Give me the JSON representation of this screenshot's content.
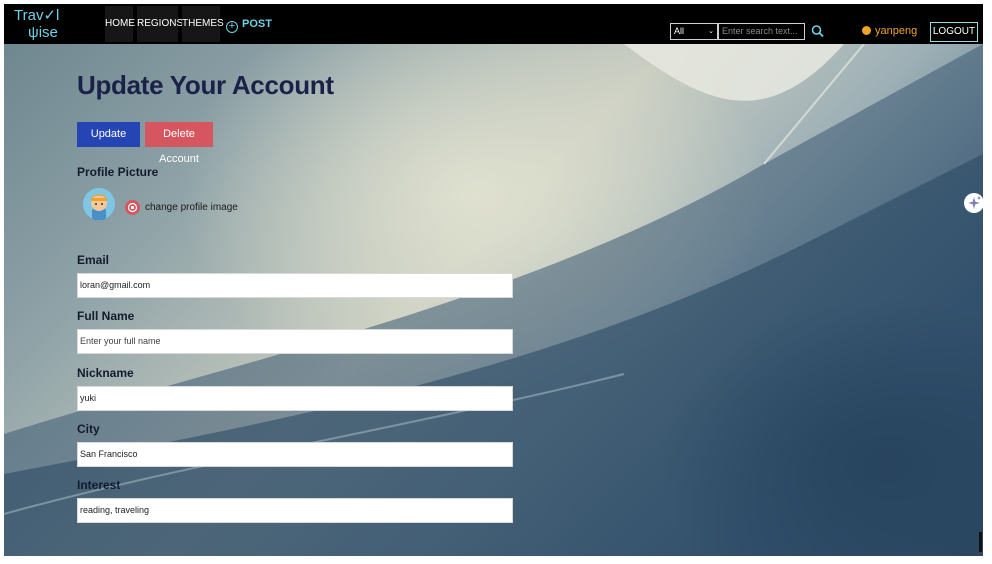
{
  "logo": {
    "line1": "Trav✓l",
    "line2": "ψise"
  },
  "nav": {
    "home": "HOME",
    "regions": "REGIONS",
    "themes": "THEMES",
    "post": "POST",
    "search": {
      "category": "All",
      "placeholder": "Enter search text..."
    },
    "user": "yanpeng",
    "logout": "LOGOUT"
  },
  "page": {
    "title": "Update Your Account",
    "update_label": "Update",
    "delete_label": "Delete Account",
    "profile_picture_label": "Profile Picture",
    "change_image_label": "change profile image"
  },
  "form": {
    "email": {
      "label": "Email",
      "value": "loran@gmail.com"
    },
    "full_name": {
      "label": "Full Name",
      "placeholder": "Enter your full name"
    },
    "nickname": {
      "label": "Nickname",
      "value": "yuki"
    },
    "city": {
      "label": "City",
      "value": "San Francisco"
    },
    "interest": {
      "label": "Interest",
      "value": "reading, traveling"
    }
  },
  "colors": {
    "navbar": "#000000",
    "logo": "#6fd1e6",
    "title": "#1c2148",
    "update_button": "#2645b5",
    "delete_button": "#d5565e",
    "user": "#f0a22a"
  },
  "icons": [
    "plus-circle-icon",
    "chevron-down-icon",
    "search-icon",
    "user-circle-icon",
    "avatar-image",
    "camera-icon",
    "sparkle-icon"
  ]
}
